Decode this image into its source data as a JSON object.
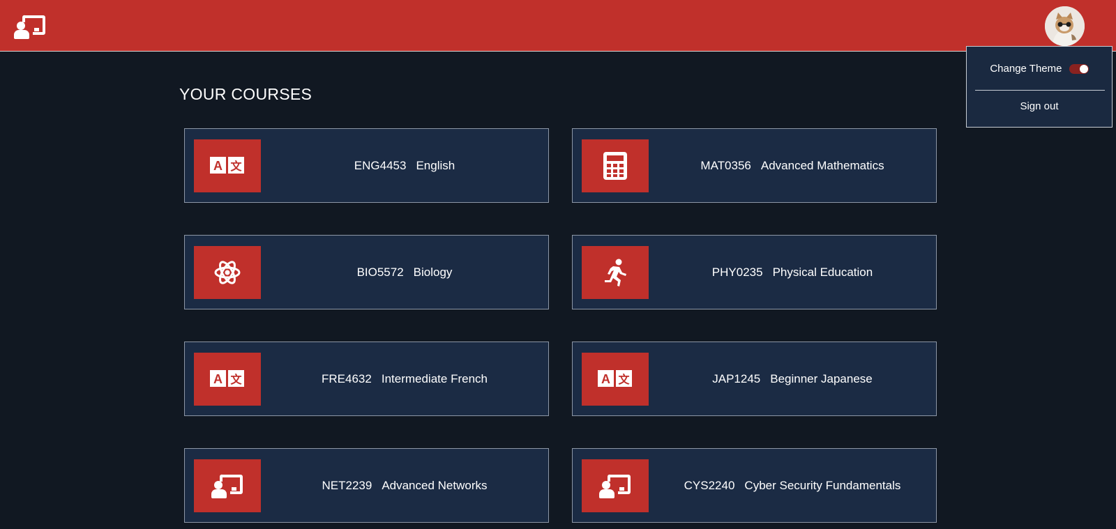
{
  "header": {
    "logo_icon": "classroom-presenter-icon",
    "avatar_icon": "user-avatar",
    "brand_color": "#c0302b"
  },
  "menu": {
    "change_theme_label": "Change Theme",
    "theme_toggle_on": true,
    "sign_out_label": "Sign out"
  },
  "page": {
    "title": "YOUR COURSES"
  },
  "courses": [
    {
      "code": "ENG4453",
      "name": "English",
      "icon": "translate-icon"
    },
    {
      "code": "MAT0356",
      "name": "Advanced Mathematics",
      "icon": "calculator-icon"
    },
    {
      "code": "BIO5572",
      "name": "Biology",
      "icon": "atom-icon"
    },
    {
      "code": "PHY0235",
      "name": "Physical Education",
      "icon": "running-person-icon"
    },
    {
      "code": "FRE4632",
      "name": "Intermediate French",
      "icon": "translate-icon"
    },
    {
      "code": "JAP1245",
      "name": "Beginner Japanese",
      "icon": "translate-icon"
    },
    {
      "code": "NET2239",
      "name": "Advanced Networks",
      "icon": "classroom-presenter-icon"
    },
    {
      "code": "CYS2240",
      "name": "Cyber Security Fundamentals",
      "icon": "classroom-presenter-icon"
    }
  ],
  "colors": {
    "background": "#111822",
    "card": "#1b2b44",
    "accent": "#c0302b"
  }
}
